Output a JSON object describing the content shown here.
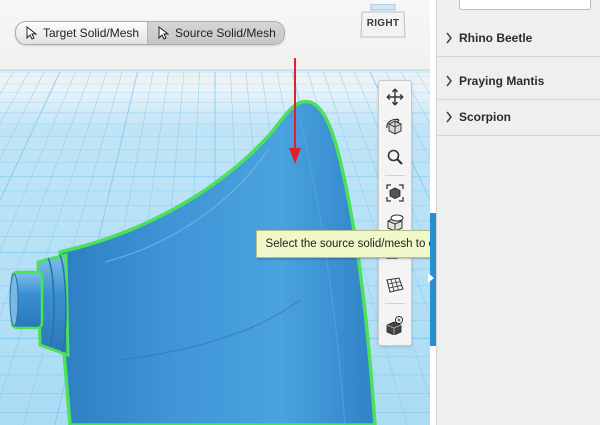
{
  "toolbar_modes": {
    "items": [
      {
        "label": "Target Solid/Mesh",
        "icon": "cursor-arrow-icon",
        "active": false
      },
      {
        "label": "Source Solid/Mesh",
        "icon": "cursor-arrow-icon",
        "active": true
      }
    ]
  },
  "viewcube": {
    "face_label": "RIGHT"
  },
  "nav_toolbar": {
    "icons": [
      "move-pan-icon",
      "orbit-icon",
      "zoom-icon",
      "fit-view-icon",
      "view-perspective-icon",
      "section-plane-icon",
      "material-grid-icon",
      "snap-settings-icon"
    ]
  },
  "tooltip": {
    "text": "Select the source solid/mesh to combine with target solid/mesh"
  },
  "side_panel": {
    "items": [
      {
        "label": "Rhino Beetle"
      },
      {
        "label": "Praying Mantis"
      },
      {
        "label": "Scorpion"
      }
    ]
  },
  "colors": {
    "model_fill": "#3a8fd0",
    "selection_outline": "#4be15a",
    "grid_line": "#7cc6ec",
    "pointer_arrow": "#e0202a",
    "tooltip_bg": "#f2f7c9",
    "panel_tab": "#2790d0"
  }
}
